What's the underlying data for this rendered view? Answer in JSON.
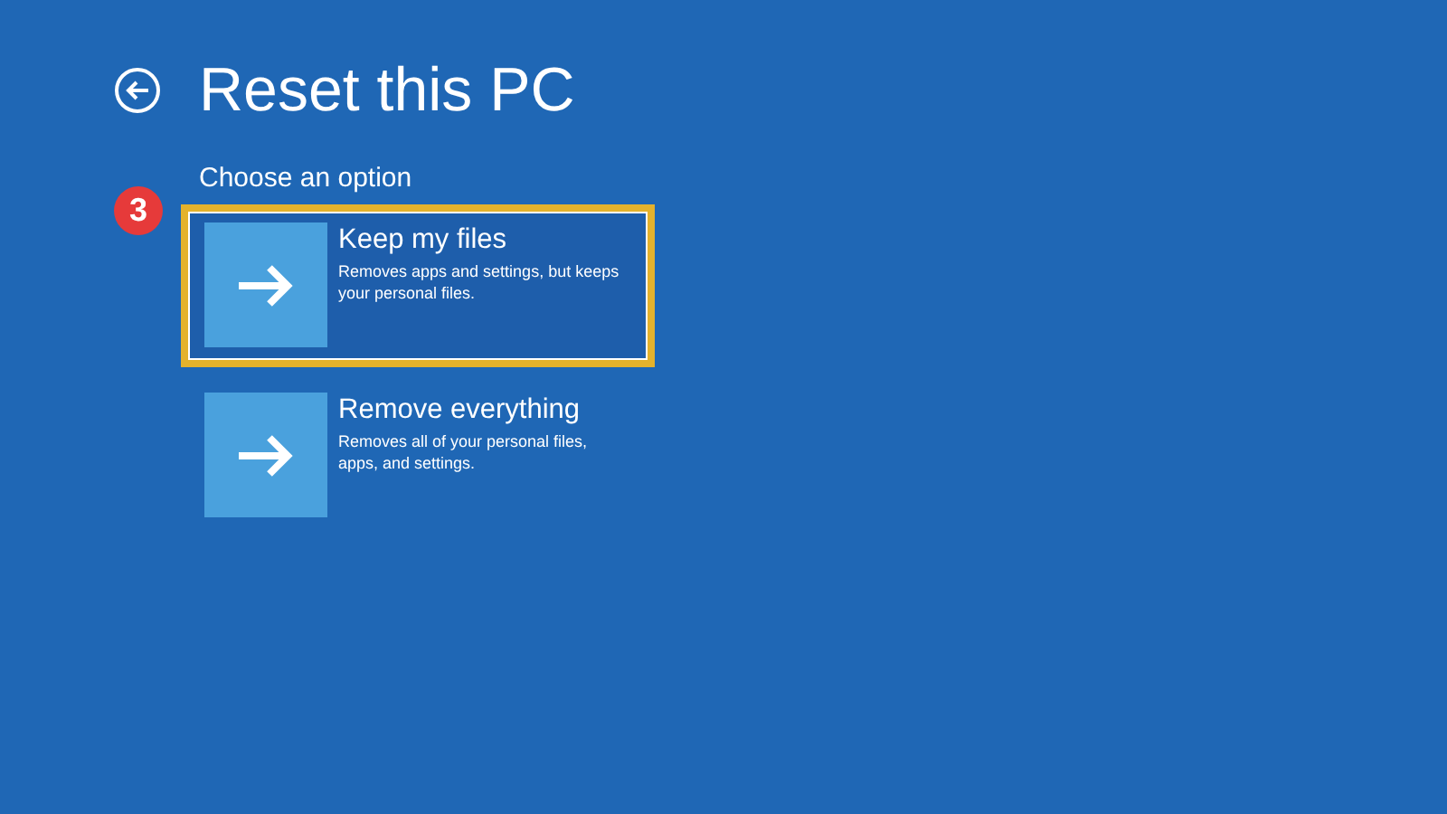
{
  "page": {
    "title": "Reset this PC",
    "subtitle": "Choose an option"
  },
  "callout": {
    "number": "3"
  },
  "options": [
    {
      "title": "Keep my files",
      "description": "Removes apps and settings, but keeps your personal files.",
      "selected": true,
      "highlighted": true
    },
    {
      "title": "Remove everything",
      "description": "Removes all of your personal files, apps, and settings.",
      "selected": false,
      "highlighted": false
    }
  ]
}
